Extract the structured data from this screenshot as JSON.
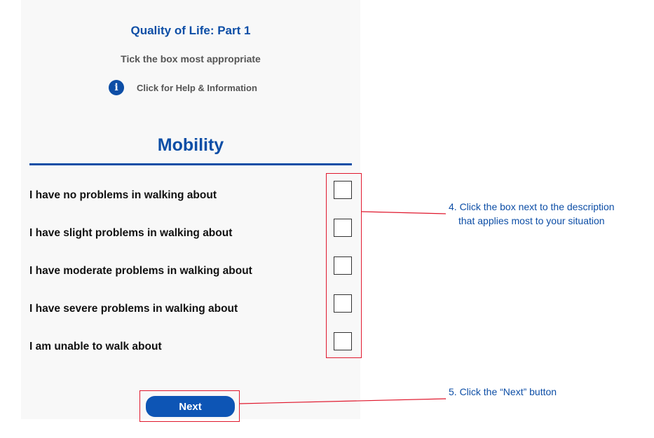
{
  "header": {
    "title": "Quality of Life: Part 1",
    "subtitle": "Tick the box most appropriate",
    "help": {
      "icon": "info-icon",
      "label": "Click for Help & Information"
    }
  },
  "section": {
    "title": "Mobility",
    "options": [
      {
        "label": "I have no problems in walking about",
        "checked": false
      },
      {
        "label": "I have slight problems in walking about",
        "checked": false
      },
      {
        "label": "I have moderate problems in walking about",
        "checked": false
      },
      {
        "label": "I have severe problems in walking about",
        "checked": false
      },
      {
        "label": "I am unable to walk about",
        "checked": false
      }
    ]
  },
  "actions": {
    "next_label": "Next"
  },
  "annotations": {
    "step4_line1": "4. Click the box next to the description",
    "step4_line2": "that applies most to your situation",
    "step5": "5. Click the “Next” button"
  },
  "colors": {
    "brand_blue": "#0d4ea6",
    "button_blue": "#0d55b5",
    "highlight_red": "#e0182d"
  }
}
